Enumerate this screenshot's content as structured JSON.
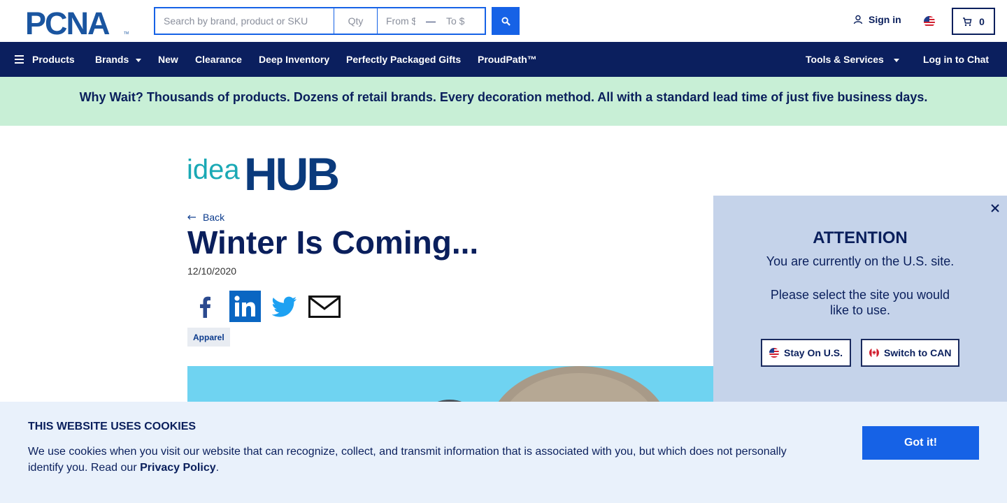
{
  "header": {
    "logo_text": "PCNA",
    "search": {
      "placeholder": "Search by brand, product or SKU",
      "value": ""
    },
    "qty": {
      "placeholder": "Qty"
    },
    "price_from": {
      "placeholder": "From $"
    },
    "price_to": {
      "placeholder": "To $"
    },
    "signin_label": "Sign in",
    "cart_count": "0",
    "region_flag": "us-flag-icon"
  },
  "nav": {
    "items": [
      {
        "label": "Products"
      },
      {
        "label": "Brands"
      },
      {
        "label": "New"
      },
      {
        "label": "Clearance"
      },
      {
        "label": "Deep Inventory"
      },
      {
        "label": "Perfectly Packaged Gifts"
      },
      {
        "label": "ProudPath™"
      }
    ],
    "tools_label": "Tools & Services",
    "chat_label": "Log in to Chat"
  },
  "banner": {
    "text": "Why Wait? Thousands of products. Dozens of retail brands. Every decoration method. All with a standard lead time of just five business days."
  },
  "article": {
    "brand_idea": "idea",
    "brand_hub": "HUB",
    "back_label": "Back",
    "title": "Winter Is Coming...",
    "date": "12/10/2020",
    "share_icons": [
      "facebook-icon",
      "linkedin-icon",
      "twitter-icon",
      "email-icon"
    ],
    "tag": "Apparel"
  },
  "attention": {
    "title": "ATTENTION",
    "message": "You are currently on the U.S. site.",
    "prompt": "Please select the site you would like to use.",
    "stay_label": "Stay On U.S.",
    "switch_label": "Switch to CAN"
  },
  "cookies": {
    "title": "THIS WEBSITE USES COOKIES",
    "text": "We use cookies when you visit our website that can recognize, collect, and transmit information that is associated with you, but which does not personally identify you. Read our ",
    "link_label": "Privacy Policy",
    "text_end": ".",
    "button_label": "Got it!"
  },
  "colors": {
    "navy": "#0b1f5e",
    "accent_blue": "#1662e6",
    "banner_green": "#c8efd6",
    "panel_blue": "#c5d3ea",
    "cookie_bg": "#e9f1fb",
    "idea_teal": "#1aa9b5",
    "hub_navy": "#0a3a7c"
  }
}
